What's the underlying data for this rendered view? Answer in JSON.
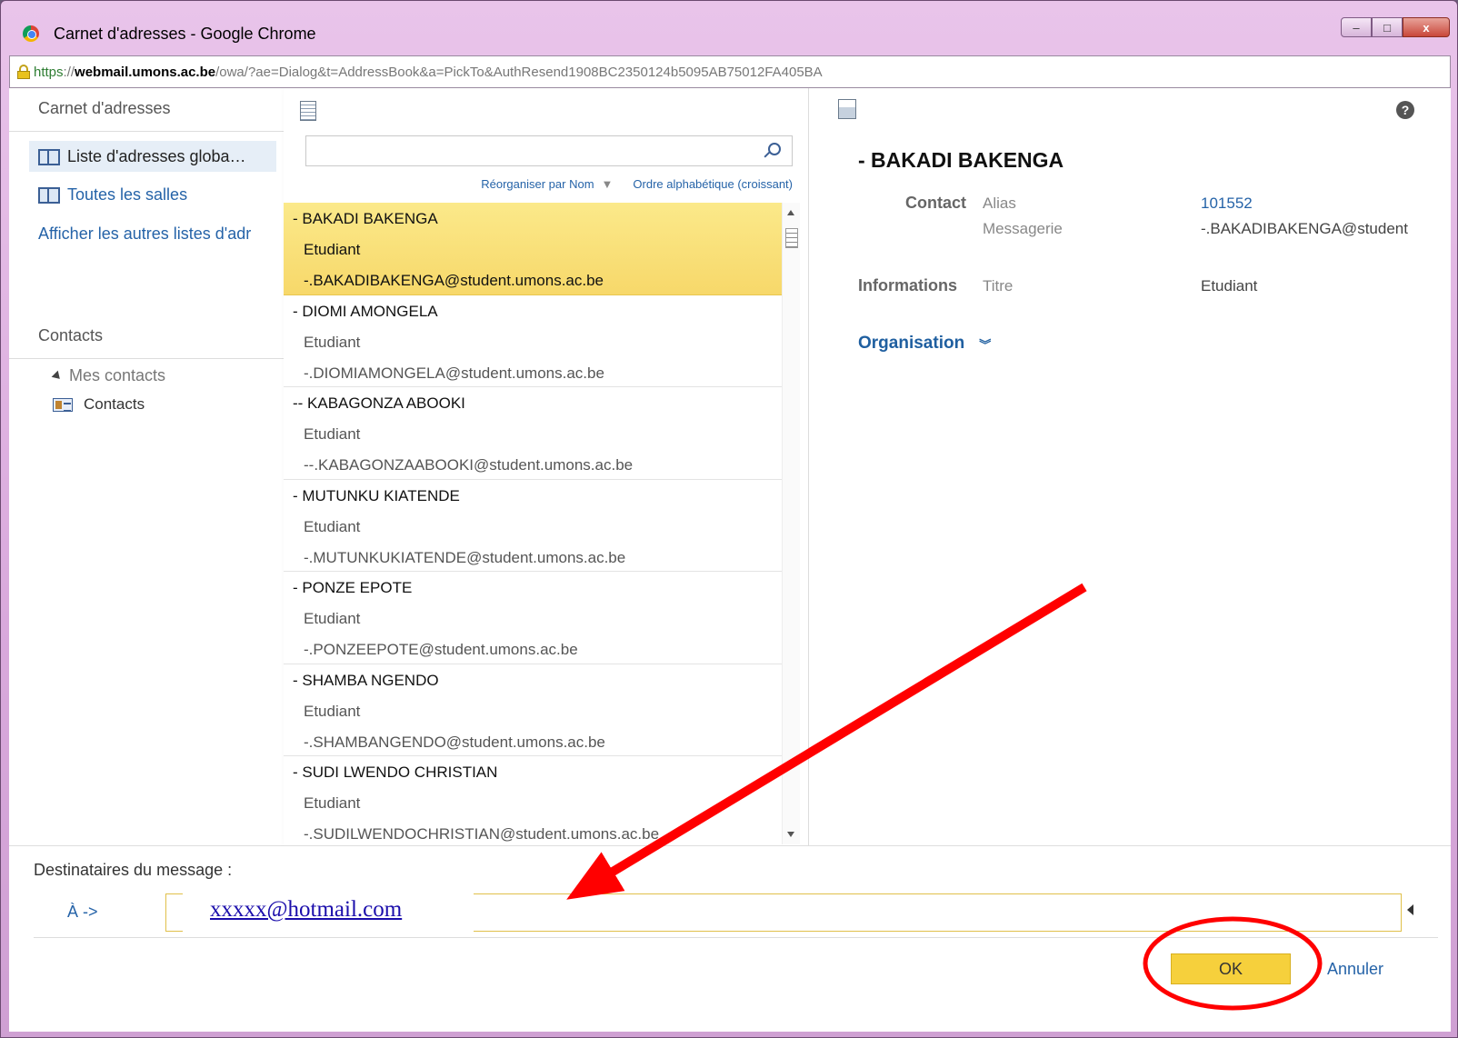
{
  "window": {
    "title": "Carnet d'adresses - Google Chrome",
    "controls": {
      "minimize": "–",
      "maximize": "□",
      "close": "x"
    }
  },
  "addressbar": {
    "scheme": "https",
    "host_rest": "://",
    "host": "webmail.umons.ac.be",
    "path": "/owa/?ae=Dialog&t=AddressBook&a=PickTo&AuthResend1908BC2350124b5095AB75012FA405BA"
  },
  "left_pane": {
    "address_book_heading": "Carnet d'adresses",
    "items": [
      {
        "label": "Liste d'adresses globa…"
      },
      {
        "label": "Toutes les salles"
      }
    ],
    "more_lists_link": "Afficher les autres listes d'adr",
    "contacts_heading": "Contacts",
    "my_contacts": "Mes contacts",
    "contacts_folder": "Contacts"
  },
  "middle_pane": {
    "search_placeholder": "",
    "sort_by": "Réorganiser par Nom",
    "sort_order": "Ordre alphabétique (croissant)",
    "results": [
      {
        "name": "- BAKADI BAKENGA",
        "title": "Etudiant",
        "email": "-.BAKADIBAKENGA@student.umons.ac.be"
      },
      {
        "name": "- DIOMI AMONGELA",
        "title": "Etudiant",
        "email": "-.DIOMIAMONGELA@student.umons.ac.be"
      },
      {
        "name": "-- KABAGONZA ABOOKI",
        "title": "Etudiant",
        "email": "--.KABAGONZAABOOKI@student.umons.ac.be"
      },
      {
        "name": "- MUTUNKU KIATENDE",
        "title": "Etudiant",
        "email": "-.MUTUNKUKIATENDE@student.umons.ac.be"
      },
      {
        "name": "- PONZE EPOTE",
        "title": "Etudiant",
        "email": "-.PONZEEPOTE@student.umons.ac.be"
      },
      {
        "name": "- SHAMBA NGENDO",
        "title": "Etudiant",
        "email": "-.SHAMBANGENDO@student.umons.ac.be"
      },
      {
        "name": "- SUDI LWENDO CHRISTIAN",
        "title": "Etudiant",
        "email": "-.SUDILWENDOCHRISTIAN@student.umons.ac.be"
      }
    ]
  },
  "detail": {
    "name": "- BAKADI BAKENGA",
    "contact_label": "Contact",
    "alias_label": "Alias",
    "alias_value": "101552",
    "mail_label": "Messagerie",
    "mail_value": "-.BAKADIBAKENGA@student",
    "info_label": "Informations",
    "title_label": "Titre",
    "title_value": "Etudiant",
    "organisation": "Organisation",
    "organisation_chevron": "»"
  },
  "footer": {
    "recipients_label": "Destinataires du message :",
    "to_label": "À ->",
    "to_value": "xxxxx@hotmail.com",
    "ok_label": "OK",
    "cancel_label": "Annuler"
  },
  "colors": {
    "selection": "#f7d86a",
    "link": "#2563a8",
    "annotation": "#ff0000"
  }
}
